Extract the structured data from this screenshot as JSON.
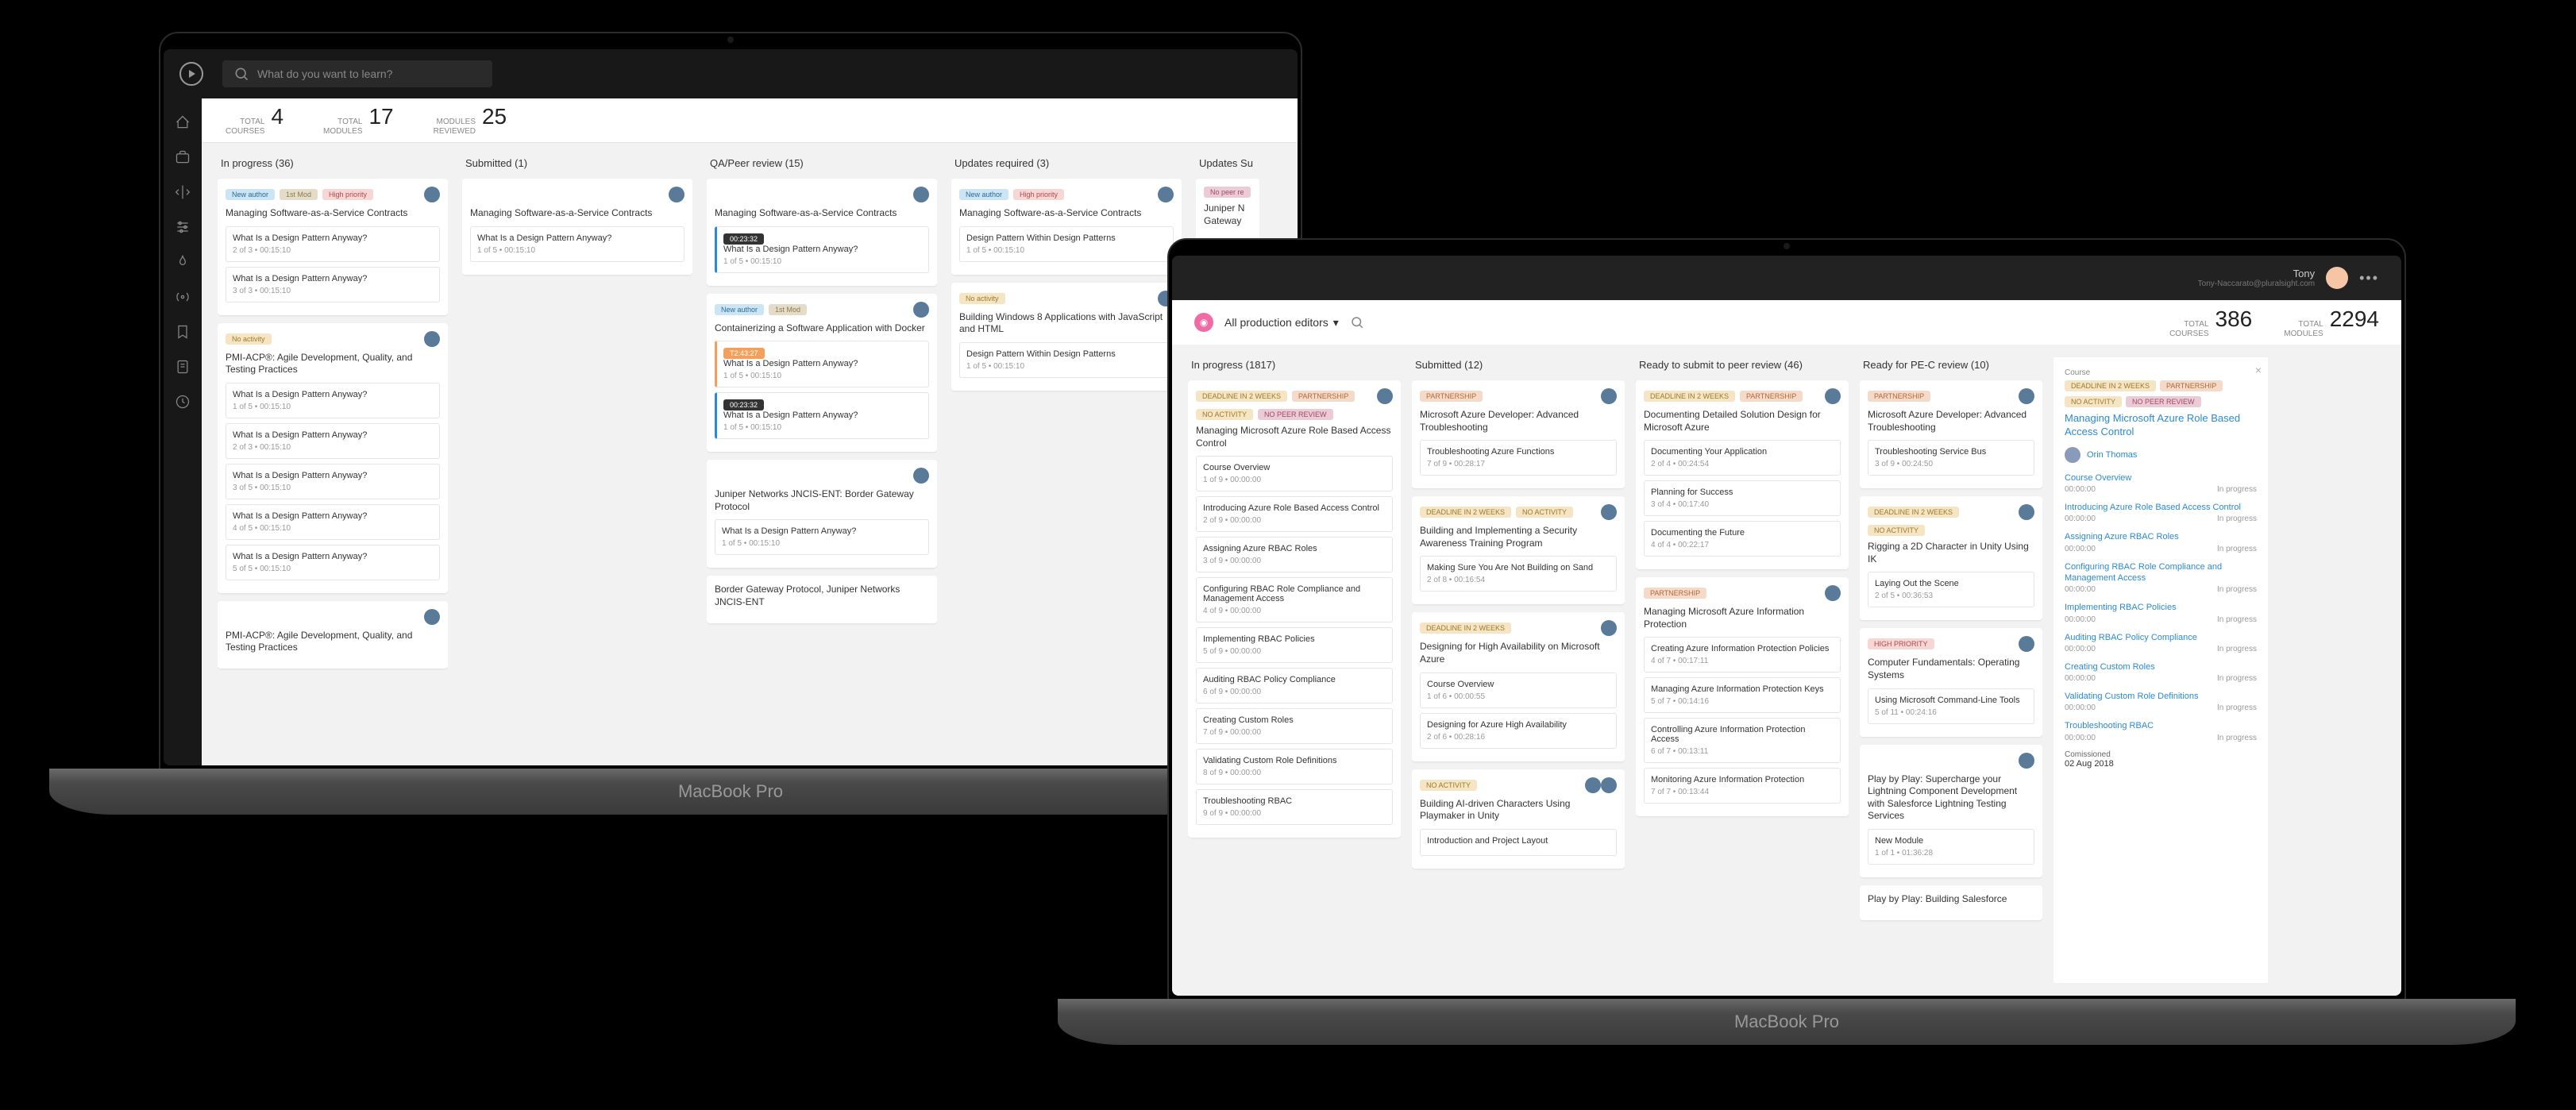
{
  "base_text": "MacBook Pro",
  "screen1": {
    "search_placeholder": "What do you want to learn?",
    "stats": [
      {
        "label1": "TOTAL",
        "label2": "COURSES",
        "value": "4"
      },
      {
        "label1": "TOTAL",
        "label2": "MODULES",
        "value": "17"
      },
      {
        "label1": "MODULES",
        "label2": "REVIEWED",
        "value": "25"
      }
    ],
    "columns": [
      {
        "header": "In progress (36)"
      },
      {
        "header": "Submitted (1)"
      },
      {
        "header": "QA/Peer review (15)"
      },
      {
        "header": "Updates required (3)"
      },
      {
        "header": "Updates Su"
      }
    ],
    "texts": {
      "card1_title": "Managing Software-as-a-Service Contracts",
      "card2_title": "PMI-ACP®: Agile Development, Quality, and Testing Practices",
      "card3_title": "Containerizing a Software Application with Docker",
      "card4_title": "Juniper Networks JNCIS-ENT: Border Gateway Protocol",
      "card5_title": "Border Gateway Protocol, Juniper Networks JNCIS-ENT",
      "card6_title": "Building Windows 8 Applications with JavaScript and HTML",
      "card7_partial": "Juniper N\nGateway",
      "sub_title": "What Is a Design Pattern Anyway?",
      "sub_title2": "Design Pattern Within Design Patterns",
      "meta_2of3": "2 of 3",
      "meta_3of3": "3 of 3",
      "meta_1of5": "1 of 5",
      "meta_4of5": "4 of 5",
      "meta_5of5": "5 of 5",
      "meta_3of5": "3 of 5",
      "meta_time": "00:15:10",
      "tag_newauthor": "New author",
      "tag_1stmod": "1st Mod",
      "tag_highpriority": "High priority",
      "tag_noactivity": "No activity",
      "tag_nopeer": "No peer re",
      "time1": "00:23:32",
      "time2": "T2:43:27",
      "time3": "00:23:32"
    }
  },
  "screen2": {
    "user_name": "Tony",
    "user_email": "Tony-Naccarato@pluralsight.com",
    "dropdown": "All production editors",
    "stats": [
      {
        "label1": "TOTAL",
        "label2": "COURSES",
        "value": "386"
      },
      {
        "label1": "TOTAL",
        "label2": "MODULES",
        "value": "2294"
      }
    ],
    "columns": [
      {
        "header": "In progress (1817)"
      },
      {
        "header": "Submitted (12)"
      },
      {
        "header": "Ready to submit to peer review (46)"
      },
      {
        "header": "Ready for PE-C review (10)"
      }
    ],
    "tags": {
      "deadline": "DEADLINE IN 2 WEEKS",
      "partnership": "PARTNERSHIP",
      "noactivity": "NO ACTIVITY",
      "nopeer": "NO PEER REVIEW",
      "highpriority": "HIGH PRIORITY"
    },
    "c1": {
      "t1": "Managing Microsoft Azure Role Based Access Control",
      "s1": "Course Overview",
      "s1m": "1 of 9  •  00:00:00",
      "s2": "Introducing Azure Role Based Access Control",
      "s2m": "2 of 9  •  00:00:00",
      "s3": "Assigning Azure RBAC Roles",
      "s3m": "3 of 9  •  00:00:00",
      "s4": "Configuring RBAC Role Compliance and Management Access",
      "s4m": "4 of 9  •  00:00:00",
      "s5": "Implementing RBAC Policies",
      "s5m": "5 of 9  •  00:00:00",
      "s6": "Auditing RBAC Policy Compliance",
      "s6m": "6 of 9  •  00:00:00",
      "s7": "Creating Custom Roles",
      "s7m": "7 of 9  •  00:00:00",
      "s8": "Validating Custom Role Definitions",
      "s8m": "8 of 9  •  00:00:00",
      "s9": "Troubleshooting RBAC",
      "s9m": "9 of 9  •  00:00:00"
    },
    "c2": {
      "t1": "Microsoft Azure Developer: Advanced Troubleshooting",
      "s1": "Troubleshooting Azure Functions",
      "s1m": "7 of 9  •  00:28:17",
      "t2": "Building and Implementing a Security Awareness Training Program",
      "s2": "Making Sure You Are Not Building on Sand",
      "s2m": "2 of 8  •  00:16:54",
      "t3": "Designing for High Availability on Microsoft Azure",
      "s3": "Course Overview",
      "s3m": "1 of 6  •  00:00:55",
      "s4": "Designing for Azure High Availability",
      "s4m": "2 of 6  •  00:28:16",
      "t4": "Building AI-driven Characters Using Playmaker in Unity",
      "s5": "Introduction and Project Layout"
    },
    "c3": {
      "t1": "Documenting Detailed Solution Design for Microsoft Azure",
      "s1": "Documenting Your Application",
      "s1m": "2 of 4  •  00:24:54",
      "s2": "Planning for Success",
      "s2m": "3 of 4  •  00:17:40",
      "s3": "Documenting the Future",
      "s3m": "4 of 4  •  00:22:17",
      "t2": "Managing Microsoft Azure Information Protection",
      "s4": "Creating Azure Information Protection Policies",
      "s4m": "4 of 7  •  00:17:11",
      "s5": "Managing Azure Information Protection Keys",
      "s5m": "5 of 7  •  00:14:16",
      "s6": "Controlling Azure Information Protection Access",
      "s6m": "6 of 7  •  00:13:11",
      "s7": "Monitoring Azure Information Protection",
      "s7m": "7 of 7  •  00:13:44"
    },
    "c4": {
      "t1": "Microsoft Azure Developer: Advanced Troubleshooting",
      "s1": "Troubleshooting Service Bus",
      "s1m": "3 of 9  •  00:24:50",
      "t2": "Rigging a 2D Character in Unity Using IK",
      "s2": "Laying Out the Scene",
      "s2m": "2 of 5  •  00:36:53",
      "t3": "Computer Fundamentals: Operating Systems",
      "s3": "Using Microsoft Command-Line Tools",
      "s3m": "5 of 11  •  00:24:16",
      "t4": "Play by Play: Supercharge your Lightning Component Development with Salesforce Lightning Testing Services",
      "s4": "New Module",
      "s4m": "1 of 1  •  01:36:28",
      "t5": "Play by Play: Building Salesforce"
    },
    "detail": {
      "label": "Course",
      "title": "Managing Microsoft Azure Role Based Access Control",
      "person": "Orin Thomas",
      "status": "In progress",
      "commissioned_label": "Comissioned",
      "commissioned_date": "02 Aug 2018",
      "items": [
        {
          "t": "Course Overview",
          "m": "00:00:00"
        },
        {
          "t": "Introducing Azure Role Based Access Control",
          "m": "00:00:00"
        },
        {
          "t": "Assigning Azure RBAC Roles",
          "m": "00:00:00"
        },
        {
          "t": "Configuring RBAC Role Compliance and Management Access",
          "m": "00:00:00"
        },
        {
          "t": "Implementing RBAC Policies",
          "m": "00:00:00"
        },
        {
          "t": "Auditing RBAC Policy Compliance",
          "m": "00:00:00"
        },
        {
          "t": "Creating Custom Roles",
          "m": "00:00:00"
        },
        {
          "t": "Validating Custom Role Definitions",
          "m": "00:00:00"
        },
        {
          "t": "Troubleshooting RBAC",
          "m": "00:00:00"
        }
      ]
    }
  }
}
